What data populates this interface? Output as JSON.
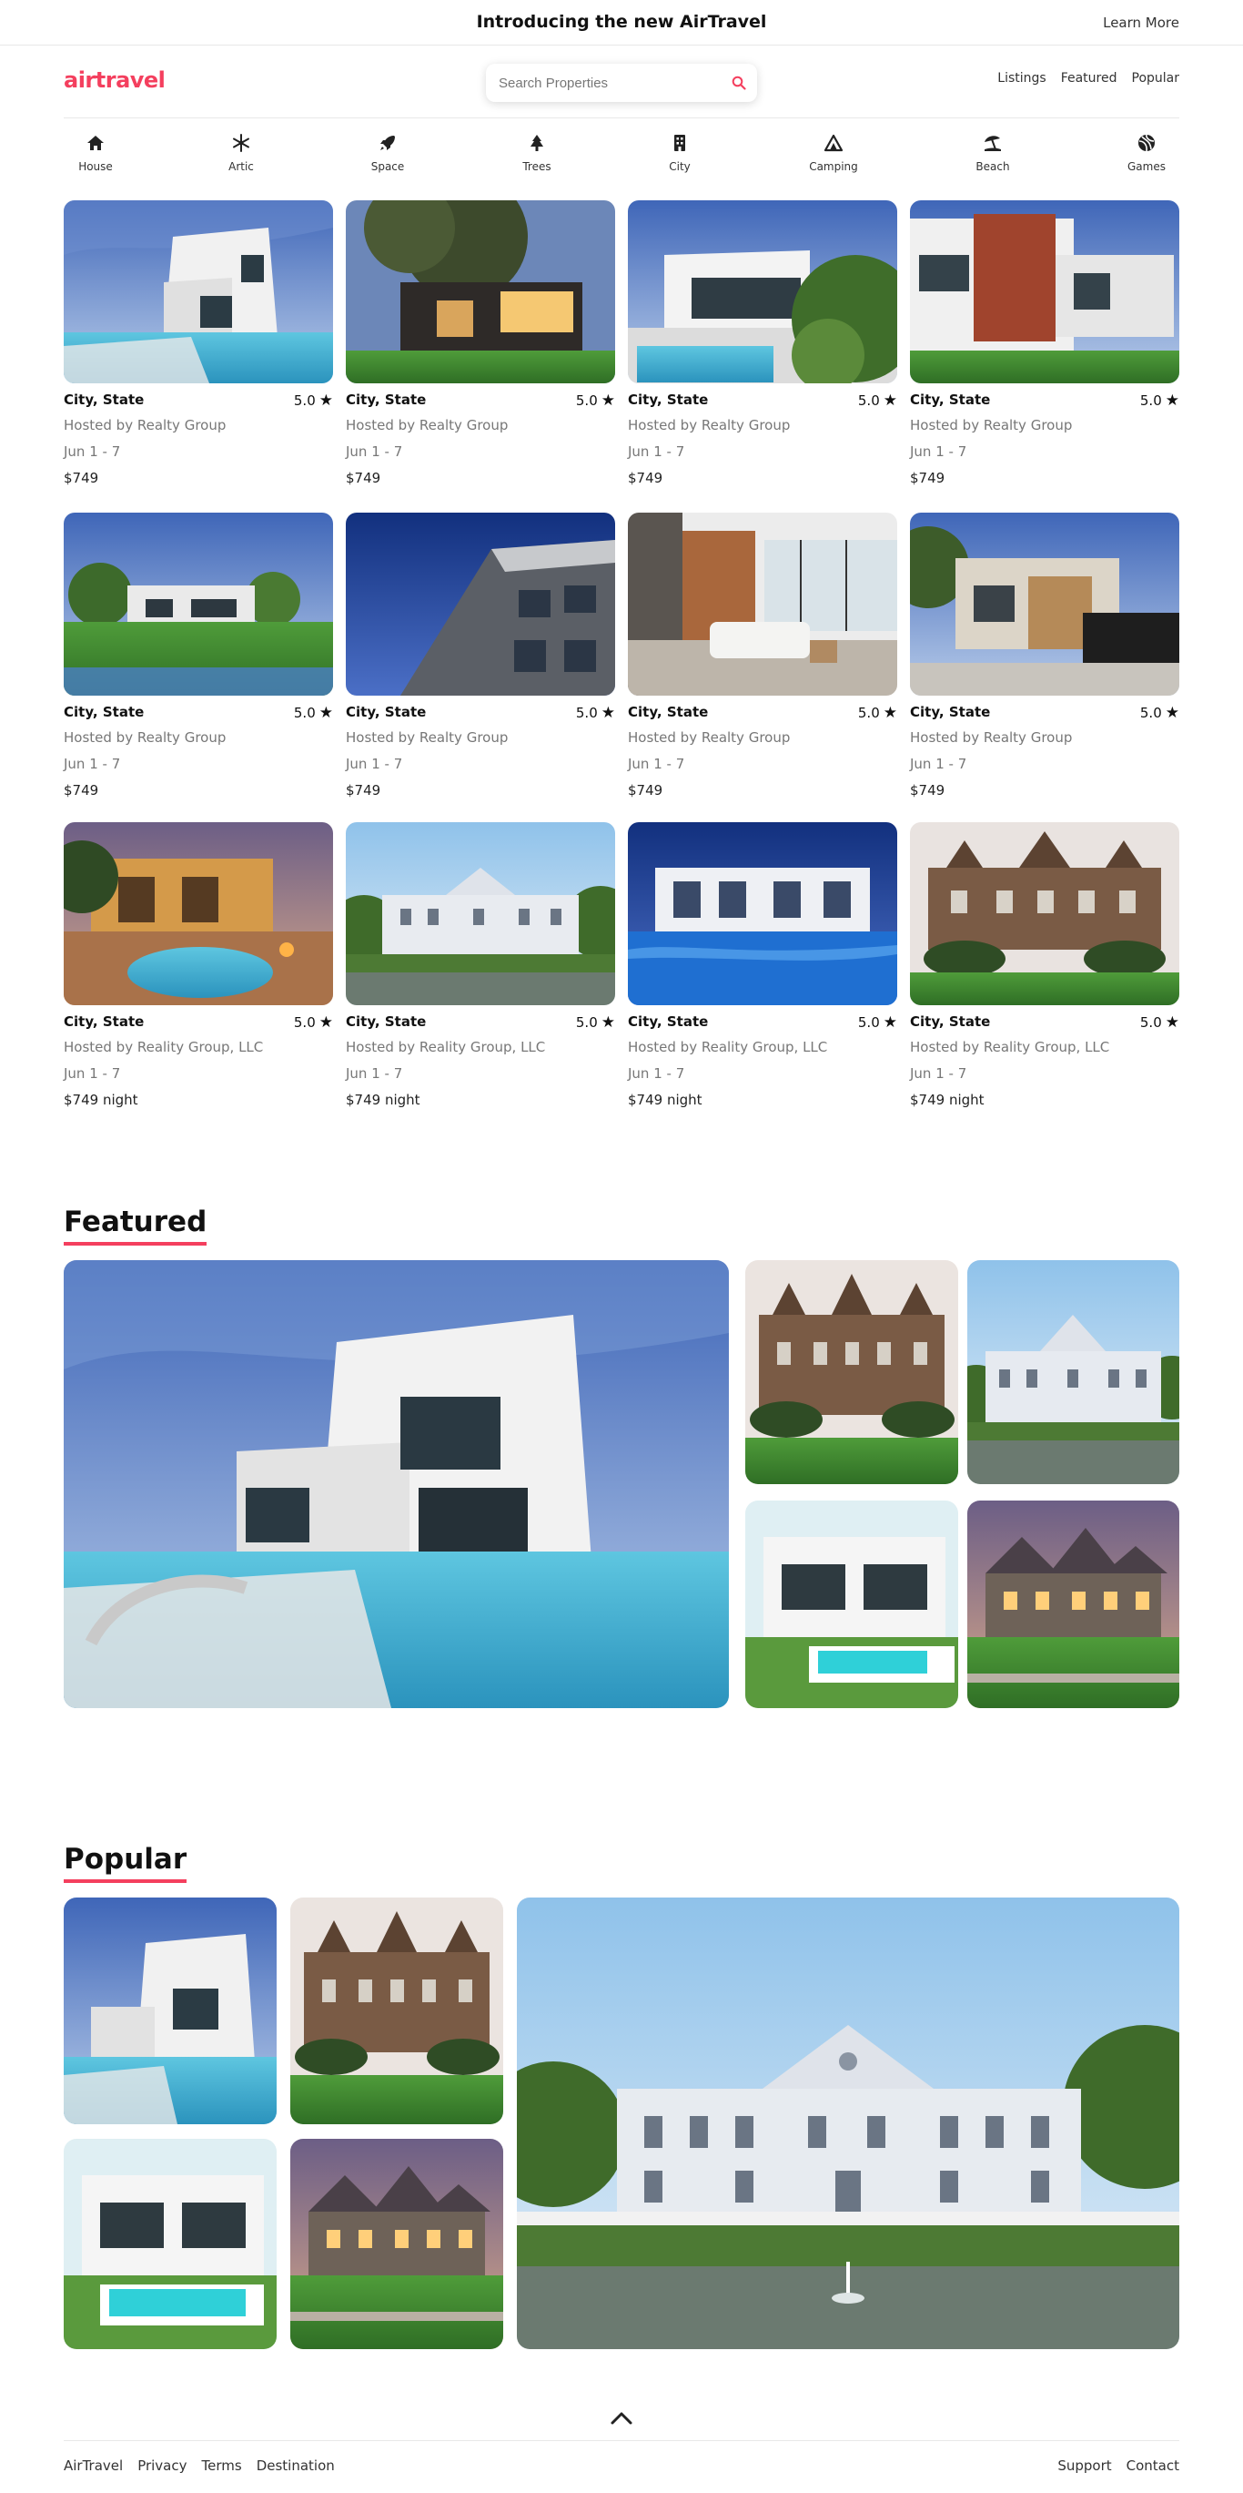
{
  "announcement": {
    "text": "Introducing the new AirTravel",
    "link": "Learn More"
  },
  "brand": {
    "logo": "airtravel",
    "accent": "#f43f5e"
  },
  "search": {
    "placeholder": "Search Properties",
    "icon": "search-icon"
  },
  "nav": [
    "Listings",
    "Featured",
    "Popular"
  ],
  "categories": [
    {
      "label": "House",
      "icon": "house-icon"
    },
    {
      "label": "Artic",
      "icon": "snowflake-icon"
    },
    {
      "label": "Space",
      "icon": "rocket-icon"
    },
    {
      "label": "Trees",
      "icon": "tree-icon"
    },
    {
      "label": "City",
      "icon": "building-icon"
    },
    {
      "label": "Camping",
      "icon": "tent-icon"
    },
    {
      "label": "Beach",
      "icon": "umbrella-beach-icon"
    },
    {
      "label": "Games",
      "icon": "ball-icon"
    }
  ],
  "listings": [
    {
      "location": "City, State",
      "rating": "5.0",
      "host": "Hosted by Realty Group",
      "dates": "Jun 1 - 7",
      "price": "$749"
    },
    {
      "location": "City, State",
      "rating": "5.0",
      "host": "Hosted by Realty Group",
      "dates": "Jun 1 - 7",
      "price": "$749"
    },
    {
      "location": "City, State",
      "rating": "5.0",
      "host": "Hosted by Realty Group",
      "dates": "Jun 1 - 7",
      "price": "$749"
    },
    {
      "location": "City, State",
      "rating": "5.0",
      "host": "Hosted by Realty Group",
      "dates": "Jun 1 - 7",
      "price": "$749"
    },
    {
      "location": "City, State",
      "rating": "5.0",
      "host": "Hosted by Realty Group",
      "dates": "Jun 1 - 7",
      "price": "$749"
    },
    {
      "location": "City, State",
      "rating": "5.0",
      "host": "Hosted by Realty Group",
      "dates": "Jun 1 - 7",
      "price": "$749"
    },
    {
      "location": "City, State",
      "rating": "5.0",
      "host": "Hosted by Realty Group",
      "dates": "Jun 1 - 7",
      "price": "$749"
    },
    {
      "location": "City, State",
      "rating": "5.0",
      "host": "Hosted by Realty Group",
      "dates": "Jun 1 - 7",
      "price": "$749"
    },
    {
      "location": "City, State",
      "rating": "5.0",
      "host": "Hosted by Reality Group, LLC",
      "dates": "Jun 1 - 7",
      "price": "$749 night"
    },
    {
      "location": "City, State",
      "rating": "5.0",
      "host": "Hosted by Reality Group, LLC",
      "dates": "Jun 1 - 7",
      "price": "$749 night"
    },
    {
      "location": "City, State",
      "rating": "5.0",
      "host": "Hosted by Reality Group, LLC",
      "dates": "Jun 1 - 7",
      "price": "$749 night"
    },
    {
      "location": "City, State",
      "rating": "5.0",
      "host": "Hosted by Reality Group, LLC",
      "dates": "Jun 1 - 7",
      "price": "$749 night"
    }
  ],
  "featured": {
    "title": "Featured"
  },
  "popular": {
    "title": "Popular"
  },
  "footer": {
    "left": [
      "AirTravel",
      "Privacy",
      "Terms",
      "Destination"
    ],
    "right": [
      "Support",
      "Contact"
    ]
  }
}
